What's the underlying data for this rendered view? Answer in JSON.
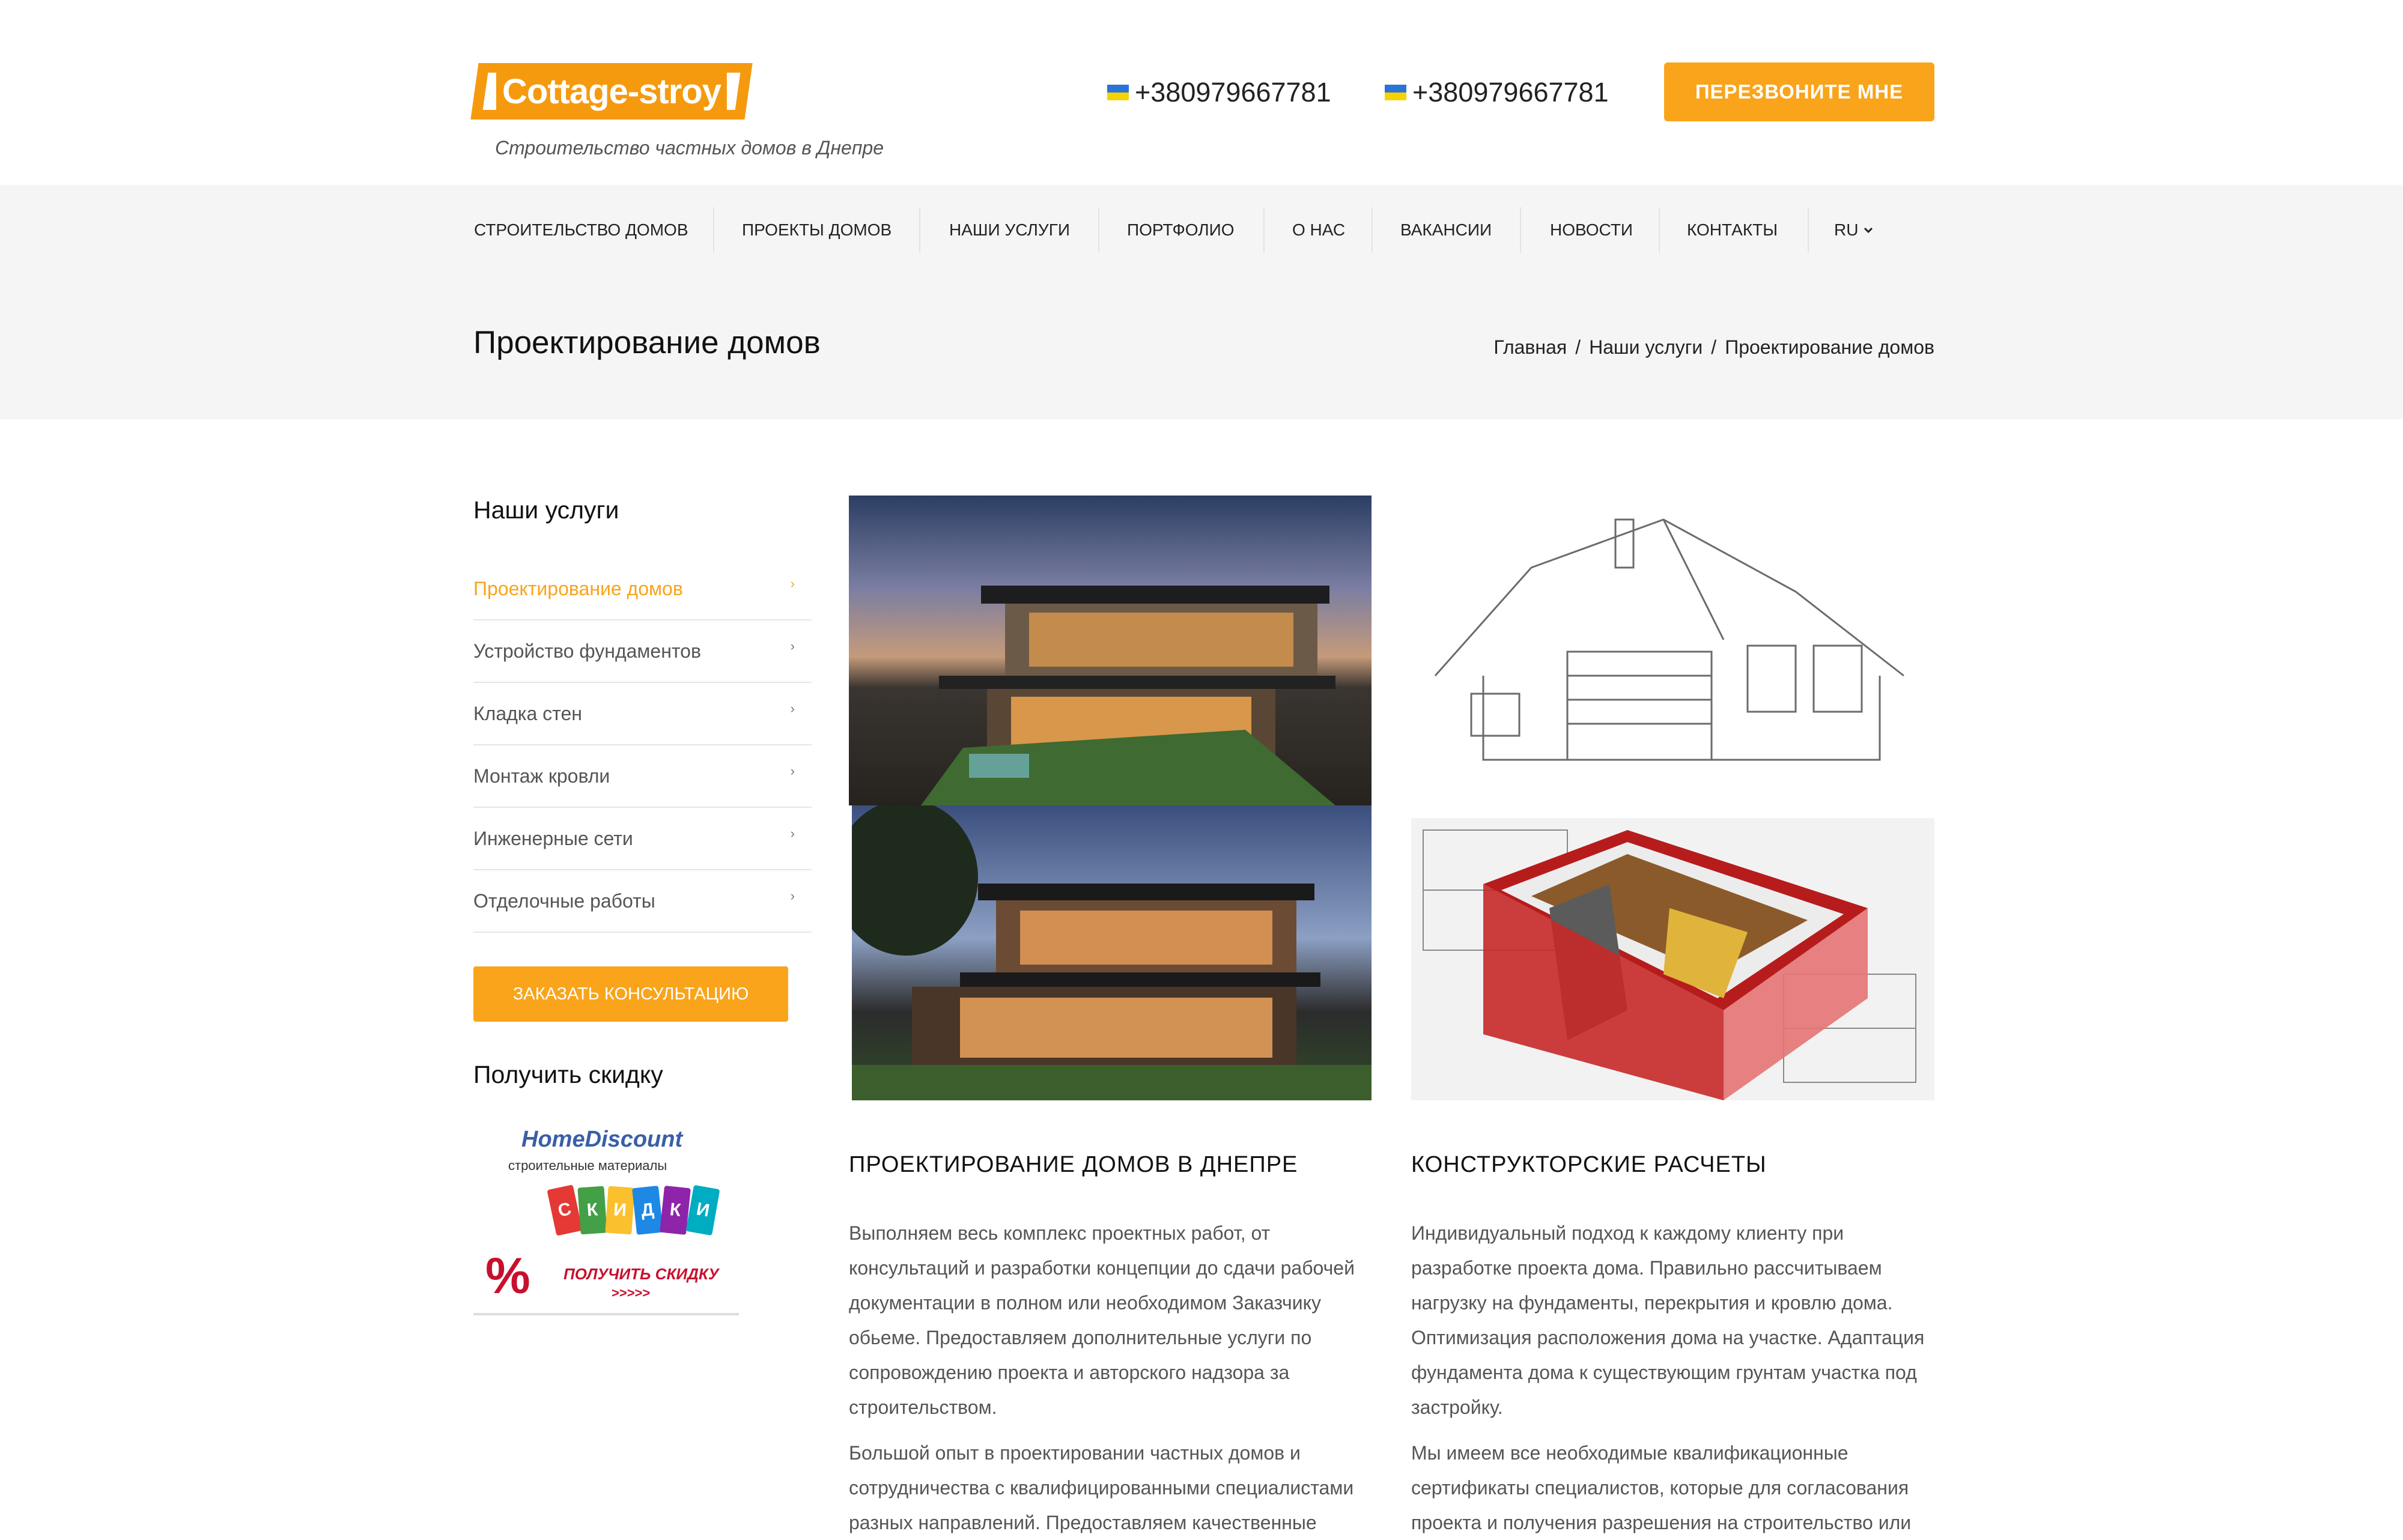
{
  "header": {
    "logo_text": "Cottage-stroy",
    "tagline": "Строительство частных домов в Днепре",
    "phone_1": "+380979667781",
    "phone_2": "+380979667781",
    "callback_button": "ПЕРЕЗВОНИТЕ МНЕ",
    "accent_color": "#f9a41a"
  },
  "nav": {
    "items": [
      "СТРОИТЕЛЬСТВО ДОМОВ",
      "ПРОЕКТЫ ДОМОВ",
      "НАШИ УСЛУГИ",
      "ПОРТФОЛИО",
      "О НАС",
      "ВАКАНСИИ",
      "НОВОСТИ",
      "КОНТАКТЫ"
    ],
    "language": "RU"
  },
  "page": {
    "title": "Проектирование домов",
    "breadcrumb": [
      "Главная",
      "/",
      "Наши услуги",
      "/",
      "Проектирование домов"
    ]
  },
  "sidebar": {
    "title": "Наши услуги",
    "items": [
      "Проектирование домов",
      "Устройство фундаментов",
      "Кладка стен",
      "Монтаж кровли",
      "Инженерные сети",
      "Отделочные работы"
    ],
    "active_index": 0,
    "consult_button": "ЗАКАЗАТЬ КОНСУЛЬТАЦИЮ",
    "discount_title": "Получить скидку",
    "banner": {
      "brand": "HomeDiscount",
      "subtitle": "строительные материалы",
      "tag_letters": [
        "С",
        "К",
        "И",
        "Д",
        "К",
        "И"
      ],
      "percent": "%",
      "cta": "ПОЛУЧИТЬ СКИДКУ",
      "arrows": ">>>>>"
    }
  },
  "content": {
    "col1": {
      "heading": "ПРОЕКТИРОВАНИЕ ДОМОВ В ДНЕПРЕ",
      "paragraph_1": "Выполняем весь комплекс проектных работ, от консультаций и разработки концепции до сдачи рабочей документации в полном или необходимом Заказчику обьеме. Предоставляем дополнительные услуги по сопровождению проекта и авторского надзора за строительством.",
      "paragraph_2": "Большой опыт в проектировании частных домов и сотрудничества с квалифицированными специалистами разных направлений. Предоставляем качественные"
    },
    "col2": {
      "heading": "КОНСТРУКТОРСКИЕ РАСЧЕТЫ",
      "paragraph_1": "Индивидуальный подход к каждому клиенту при разработке проекта дома. Правильно рассчитываем нагрузку на фундаменты, перекрытия и кровлю дома. Оптимизация расположения дома на участке. Адаптация фундамента дома к существующим грунтам участка под застройку.",
      "paragraph_2": "Мы имеем все необходимые квалификационные сертификаты специалистов, которые для согласования проекта и получения разрешения на строительство или"
    }
  }
}
